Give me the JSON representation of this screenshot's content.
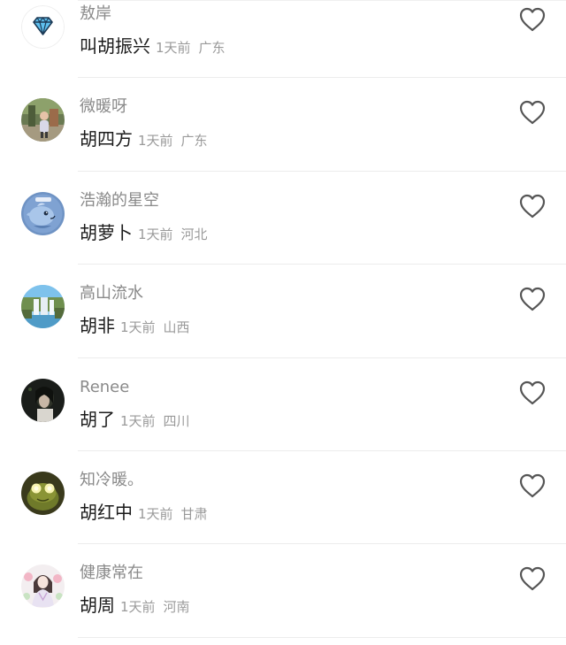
{
  "comments": [
    {
      "username": "敖岸",
      "text": "叫胡振兴",
      "time": "1天前",
      "location": "广东",
      "avatar": "diamond-avatar"
    },
    {
      "username": "微暖呀",
      "text": "胡四方",
      "time": "1天前",
      "location": "广东",
      "avatar": "child-photo-avatar"
    },
    {
      "username": "浩瀚的星空",
      "text": "胡萝卜",
      "time": "1天前",
      "location": "河北",
      "avatar": "cartoon-dolphin-avatar"
    },
    {
      "username": "高山流水",
      "text": "胡非",
      "time": "1天前",
      "location": "山西",
      "avatar": "waterfall-avatar"
    },
    {
      "username": "Renee",
      "text": "胡了",
      "time": "1天前",
      "location": "四川",
      "avatar": "dark-portrait-avatar"
    },
    {
      "username": "知冷暖。",
      "text": "胡红中",
      "time": "1天前",
      "location": "甘肃",
      "avatar": "frog-glowing-eyes-avatar"
    },
    {
      "username": "健康常在",
      "text": "胡周",
      "time": "1天前",
      "location": "河南",
      "avatar": "lady-flowers-avatar"
    }
  ],
  "icons": {
    "like": "heart-outline-icon"
  },
  "colors": {
    "username": "#8a8a8a",
    "meta": "#9a9a9a",
    "text": "#1b1b1b",
    "divider": "#ececec",
    "heart": "#555555"
  }
}
